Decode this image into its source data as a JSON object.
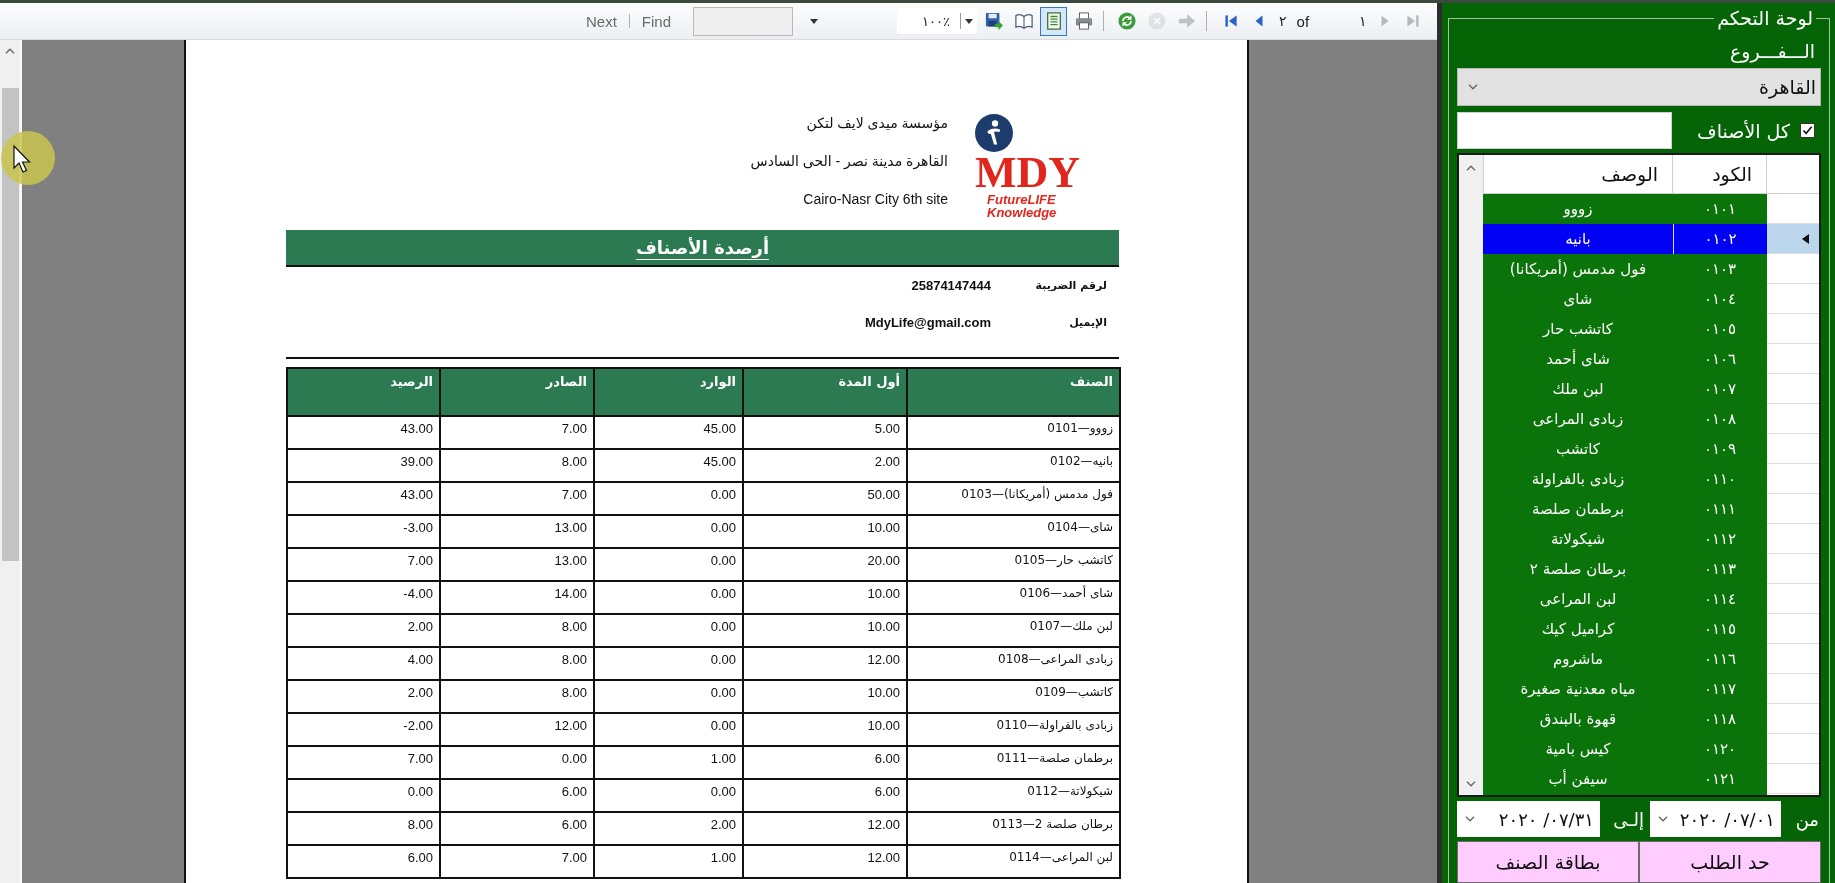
{
  "toolbar": {
    "find_link": {
      "label": "Find",
      "disabled": true
    },
    "next_link": {
      "label": "Next",
      "disabled": true
    },
    "zoom": "١٠٠٪",
    "button_groups": [
      [
        {
          "kind": "save",
          "selected": false,
          "disabled": false
        },
        {
          "kind": "layout",
          "selected": false,
          "disabled": false
        },
        {
          "kind": "page_setup",
          "selected": true,
          "disabled": false
        },
        {
          "kind": "print",
          "selected": false,
          "disabled": false
        }
      ],
      [
        {
          "kind": "refresh",
          "selected": false,
          "disabled": false
        },
        {
          "kind": "stop",
          "selected": false,
          "disabled": true
        },
        {
          "kind": "go",
          "selected": false,
          "disabled": true
        }
      ]
    ],
    "pager": {
      "buttons_before": [
        {
          "kind": "first",
          "disabled": false
        },
        {
          "kind": "previous",
          "disabled": false
        }
      ],
      "page_number": "٢",
      "of_label": "of",
      "page_count": "١",
      "buttons_after": [
        {
          "kind": "next",
          "disabled": true
        },
        {
          "kind": "last",
          "disabled": true
        }
      ]
    }
  },
  "report": {
    "company": {
      "name": "مؤسسة ميدى لايف لتكن",
      "address_lines": [
        "القاهرة مدينة نصر - الحى السادس",
        "Cairo-Nasr City 6th site"
      ]
    },
    "logo": {
      "mark": "MDY",
      "tagline": [
        "FutureLIFE",
        "Knowledge"
      ]
    },
    "title": "أرصدة الأصناف",
    "info": [
      {
        "label": "لرقم الضريبة",
        "value": "25874147444"
      },
      {
        "label": "الإيميل",
        "value": "MdyLife@gmail.com"
      }
    ],
    "table": {
      "columns": [
        "الصنف",
        "أول المدة",
        "الوارد",
        "الصادر",
        "الرصيد"
      ],
      "rows": [
        [
          "زووو—0101",
          "5.00",
          "45.00",
          "7.00",
          "43.00"
        ],
        [
          "بانيه—0102",
          "2.00",
          "45.00",
          "8.00",
          "39.00"
        ],
        [
          "فول مدمس (أمريكانا)—0103",
          "50.00",
          "0.00",
          "7.00",
          "43.00"
        ],
        [
          "شاى—0104",
          "10.00",
          "0.00",
          "13.00",
          "-3.00"
        ],
        [
          "كاتشب حار—0105",
          "20.00",
          "0.00",
          "13.00",
          "7.00"
        ],
        [
          "شاى أحمد—0106",
          "10.00",
          "0.00",
          "14.00",
          "-4.00"
        ],
        [
          "لبن ملك—0107",
          "10.00",
          "0.00",
          "8.00",
          "2.00"
        ],
        [
          "زبادى المراعى—0108",
          "12.00",
          "0.00",
          "8.00",
          "4.00"
        ],
        [
          "كاتشب—0109",
          "10.00",
          "0.00",
          "8.00",
          "2.00"
        ],
        [
          "زبادى بالفراولة—0110",
          "10.00",
          "0.00",
          "12.00",
          "-2.00"
        ],
        [
          "برطمان صلصة—0111",
          "6.00",
          "1.00",
          "0.00",
          "7.00"
        ],
        [
          "شيكولاتة—0112",
          "6.00",
          "0.00",
          "6.00",
          "0.00"
        ],
        [
          "برطان صلصة 2—0113",
          "12.00",
          "2.00",
          "6.00",
          "8.00"
        ],
        [
          "لبن المراعى—0114",
          "12.00",
          "1.00",
          "7.00",
          "6.00"
        ]
      ]
    }
  },
  "panel": {
    "title": "لوحة التحكم",
    "branch_label": "الـــفـــروع",
    "branch_select": {
      "value": "القاهرة"
    },
    "all_items": {
      "label": "كل الأصناف",
      "checked": true
    },
    "grid": {
      "columns": [
        "الكود",
        "الوصف"
      ],
      "rows": [
        {
          "code": "٠١٠١",
          "name": "زووو",
          "selected": false
        },
        {
          "code": "٠١٠٢",
          "name": "بانيه",
          "selected": true
        },
        {
          "code": "٠١٠٣",
          "name": "فول مدمس (أمريكانا)",
          "selected": false
        },
        {
          "code": "٠١٠٤",
          "name": "شاى",
          "selected": false
        },
        {
          "code": "٠١٠٥",
          "name": "كاتشب حار",
          "selected": false
        },
        {
          "code": "٠١٠٦",
          "name": "شاى أحمد",
          "selected": false
        },
        {
          "code": "٠١٠٧",
          "name": "لبن ملك",
          "selected": false
        },
        {
          "code": "٠١٠٨",
          "name": "زبادى المراعى",
          "selected": false
        },
        {
          "code": "٠١٠٩",
          "name": "كاتشب",
          "selected": false
        },
        {
          "code": "٠١١٠",
          "name": "زبادى بالفراولة",
          "selected": false
        },
        {
          "code": "٠١١١",
          "name": "برطمان صلصة",
          "selected": false
        },
        {
          "code": "٠١١٢",
          "name": "شيكولاتة",
          "selected": false
        },
        {
          "code": "٠١١٣",
          "name": "برطان صلصة ٢",
          "selected": false
        },
        {
          "code": "٠١١٤",
          "name": "لبن المراعى",
          "selected": false
        },
        {
          "code": "٠١١٥",
          "name": "كراميل كيك",
          "selected": false
        },
        {
          "code": "٠١١٦",
          "name": "ماشروم",
          "selected": false
        },
        {
          "code": "٠١١٧",
          "name": "مياه معدنية صغيرة",
          "selected": false
        },
        {
          "code": "٠١١٨",
          "name": "قهوة بالبندق",
          "selected": false
        },
        {
          "code": "٠١٢٠",
          "name": "كيس بامية",
          "selected": false
        },
        {
          "code": "٠١٢١",
          "name": "سيفن أب",
          "selected": false
        }
      ]
    },
    "date_from": {
      "label": "من",
      "value": "٢٠٢٠ /٠٧/٠١"
    },
    "date_to": {
      "label": "إلـى",
      "value": "٢٠٢٠ /٠٧/٣١"
    },
    "reorder_limit_button": "حد الطلب",
    "item_card_button": "بطاقة الصنف"
  }
}
